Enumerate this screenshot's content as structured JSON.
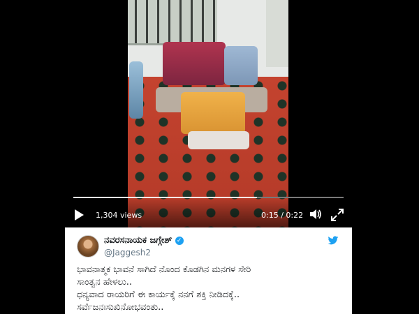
{
  "video": {
    "views": "1,304 views",
    "time": "0:15 / 0:22",
    "progress": 0.68
  },
  "tweet": {
    "display_name": "ನವರಸನಾಯಕ ಜಗ್ಗೇಶ್",
    "handle": "@Jaggesh2",
    "lines": [
      "ಭಾವನಾತ್ಮಕ ಭಾವನೆ ಸಾಗಿದೆ ನೊಂದ ಕೊಡಗಿನ ಮನಗಳ ಸೇರಿ",
      "ಸಾಂತ್ವನ ಹೇಳಲು..",
      "ಧನ್ಯವಾದ ರಾಯರಿಗೆ ಈ ಕಾರ್ಯಕ್ಕೆ ನನಗೆ ಶಕ್ತಿ ನೀಡಿದಕ್ಕೆ..",
      "ಸರ್ವೆಜನಃಸುಖಿನೋಭವಂತು.."
    ]
  },
  "icons": {
    "verified": "verified-badge-icon",
    "bird": "twitter-bird-icon",
    "play": "play-icon",
    "volume": "volume-icon",
    "fullscreen": "fullscreen-icon"
  },
  "colors": {
    "twitter_blue": "#1da1f2",
    "floor_red": "#c0402e"
  }
}
